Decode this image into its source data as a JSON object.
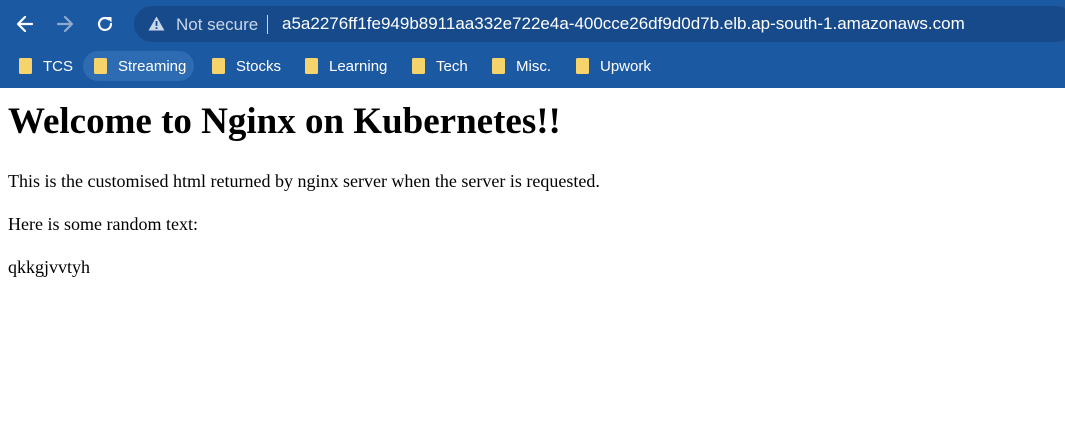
{
  "browser": {
    "security_label": "Not secure",
    "url": "a5a2276ff1fe949b8911aa332e722e4a-400cce26df9d0d7b.elb.ap-south-1.amazonaws.com",
    "bookmarks": [
      {
        "label": "TCS",
        "icon": "folder-icon"
      },
      {
        "label": "Streaming",
        "icon": "folder-icon"
      },
      {
        "label": "Stocks",
        "icon": "folder-icon"
      },
      {
        "label": "Learning",
        "icon": "folder-icon"
      },
      {
        "label": "Tech",
        "icon": "folder-icon"
      },
      {
        "label": "Misc.",
        "icon": "folder-icon"
      },
      {
        "label": "Upwork",
        "icon": "folder-icon"
      }
    ],
    "colors": {
      "toolbar": "#1c59a3",
      "omnibox": "#174a8a",
      "folder": "#f7d36b"
    }
  },
  "page": {
    "heading": "Welcome to Nginx on Kubernetes!!",
    "paragraph_1": "This is the customised html returned by nginx server when the server is requested.",
    "paragraph_2": "Here is some random text:",
    "paragraph_3": "qkkgjvvtyh"
  }
}
